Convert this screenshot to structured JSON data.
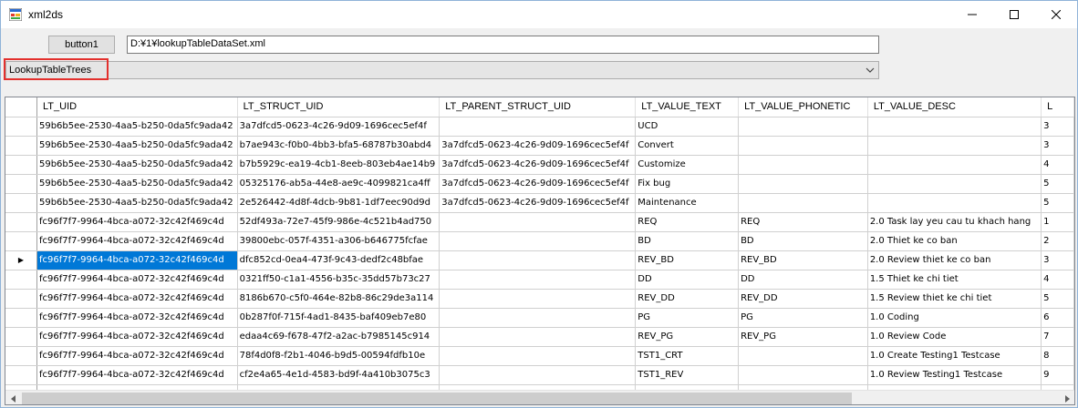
{
  "window": {
    "title": "xml2ds",
    "minimize_glyph": "—",
    "maximize_glyph": "☐",
    "close_glyph": "✕"
  },
  "toolbar": {
    "button1_label": "button1",
    "path_value": "D:¥1¥lookupTableDataSet.xml"
  },
  "table_selector": {
    "selected": "LookupTableTrees",
    "arrow_icon": "chevron-down-icon"
  },
  "grid": {
    "columns": [
      "LT_UID",
      "LT_STRUCT_UID",
      "LT_PARENT_STRUCT_UID",
      "LT_VALUE_TEXT",
      "LT_VALUE_PHONETIC",
      "LT_VALUE_DESC",
      "L"
    ],
    "current_row_glyph": "▶",
    "rows": [
      [
        "59b6b5ee-2530-4aa5-b250-0da5fc9ada42",
        "3a7dfcd5-0623-4c26-9d09-1696cec5ef4f",
        "",
        "UCD",
        "",
        "",
        "3"
      ],
      [
        "59b6b5ee-2530-4aa5-b250-0da5fc9ada42",
        "b7ae943c-f0b0-4bb3-bfa5-68787b30abd4",
        "3a7dfcd5-0623-4c26-9d09-1696cec5ef4f",
        "Convert",
        "",
        "",
        "3"
      ],
      [
        "59b6b5ee-2530-4aa5-b250-0da5fc9ada42",
        "b7b5929c-ea19-4cb1-8eeb-803eb4ae14b9",
        "3a7dfcd5-0623-4c26-9d09-1696cec5ef4f",
        "Customize",
        "",
        "",
        "4"
      ],
      [
        "59b6b5ee-2530-4aa5-b250-0da5fc9ada42",
        "05325176-ab5a-44e8-ae9c-4099821ca4ff",
        "3a7dfcd5-0623-4c26-9d09-1696cec5ef4f",
        "Fix bug",
        "",
        "",
        "5"
      ],
      [
        "59b6b5ee-2530-4aa5-b250-0da5fc9ada42",
        "2e526442-4d8f-4dcb-9b81-1df7eec90d9d",
        "3a7dfcd5-0623-4c26-9d09-1696cec5ef4f",
        "Maintenance",
        "",
        "",
        "5"
      ],
      [
        "fc96f7f7-9964-4bca-a072-32c42f469c4d",
        "52df493a-72e7-45f9-986e-4c521b4ad750",
        "",
        "REQ",
        "REQ",
        "2.0 Task lay yeu cau tu khach hang",
        "1"
      ],
      [
        "fc96f7f7-9964-4bca-a072-32c42f469c4d",
        "39800ebc-057f-4351-a306-b646775fcfae",
        "",
        "BD",
        "BD",
        "2.0 Thiet ke co ban",
        "2"
      ],
      [
        "fc96f7f7-9964-4bca-a072-32c42f469c4d",
        "dfc852cd-0ea4-473f-9c43-dedf2c48bfae",
        "",
        "REV_BD",
        "REV_BD",
        "2.0 Review thiet ke co ban",
        "3"
      ],
      [
        "fc96f7f7-9964-4bca-a072-32c42f469c4d",
        "0321ff50-c1a1-4556-b35c-35dd57b73c27",
        "",
        "DD",
        "DD",
        "1.5 Thiet ke chi tiet",
        "4"
      ],
      [
        "fc96f7f7-9964-4bca-a072-32c42f469c4d",
        "8186b670-c5f0-464e-82b8-86c29de3a114",
        "",
        "REV_DD",
        "REV_DD",
        "1.5 Review thiet ke chi tiet",
        "5"
      ],
      [
        "fc96f7f7-9964-4bca-a072-32c42f469c4d",
        "0b287f0f-715f-4ad1-8435-baf409eb7e80",
        "",
        "PG",
        "PG",
        "1.0 Coding",
        "6"
      ],
      [
        "fc96f7f7-9964-4bca-a072-32c42f469c4d",
        "edaa4c69-f678-47f2-a2ac-b7985145c914",
        "",
        "REV_PG",
        "REV_PG",
        "1.0 Review Code",
        "7"
      ],
      [
        "fc96f7f7-9964-4bca-a072-32c42f469c4d",
        "78f4d0f8-f2b1-4046-b9d5-00594fdfb10e",
        "",
        "TST1_CRT",
        "",
        "1.0 Create Testing1 Testcase",
        "8"
      ],
      [
        "fc96f7f7-9964-4bca-a072-32c42f469c4d",
        "cf2e4a65-4e1d-4583-bd9f-4a410b3075c3",
        "",
        "TST1_REV",
        "",
        "1.0 Review Testing1 Testcase",
        "9"
      ],
      [
        "",
        "",
        "",
        "",
        "",
        "",
        ""
      ]
    ],
    "current_row_index": 7,
    "selected_cell": {
      "row": 7,
      "col": 0
    }
  },
  "colors": {
    "selection": "#0078d7",
    "highlight_box": "#e3302d"
  }
}
